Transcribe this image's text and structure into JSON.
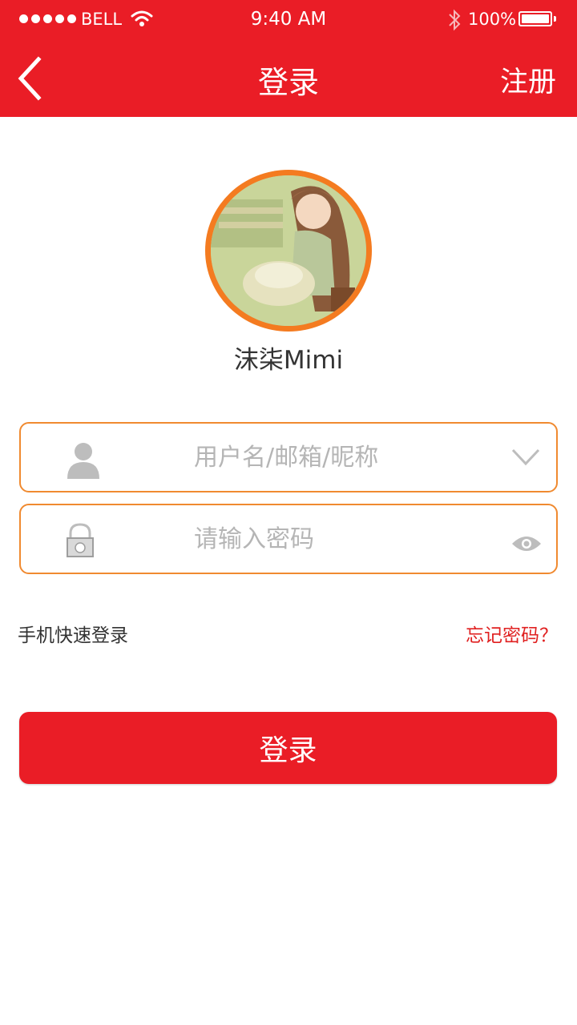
{
  "status_bar": {
    "carrier": "BELL",
    "time": "9:40 AM",
    "battery": "100%"
  },
  "nav": {
    "title": "登录",
    "register": "注册"
  },
  "profile": {
    "username": "沫柒Mimi"
  },
  "form": {
    "username_placeholder": "用户名/邮箱/昵称",
    "password_placeholder": "请输入密码"
  },
  "links": {
    "quick_login": "手机快速登录",
    "forgot_password": "忘记密码？"
  },
  "login_button": "登录",
  "colors": {
    "primary": "#ea1d26",
    "field_border": "#f08a30",
    "avatar_ring": "#f47b20",
    "link_red": "#e02020"
  }
}
